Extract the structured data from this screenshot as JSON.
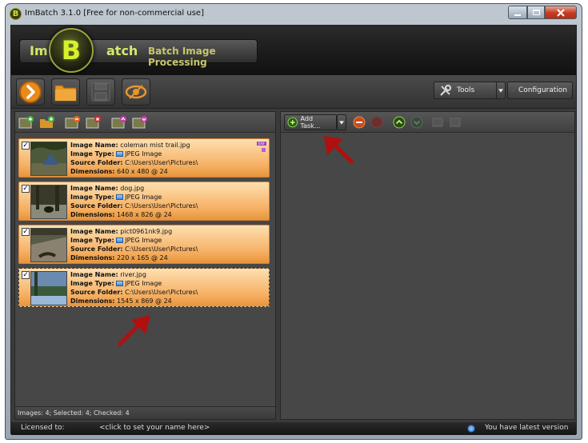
{
  "window": {
    "title": "ImBatch 3.1.0 [Free for non-commercial use]",
    "badge": "B"
  },
  "banner": {
    "logo_left": "Im",
    "logo_center": "B",
    "logo_right": "atch",
    "tagline": "Batch Image Processing"
  },
  "toolbar": {
    "tools_label": "Tools",
    "configuration_label": "Configuration"
  },
  "right_toolbar": {
    "add_task_label": "Add Task..."
  },
  "labels": {
    "image_name": "Image Name:",
    "image_type": "Image Type:",
    "source_folder": "Source Folder:",
    "dimensions": "Dimensions:",
    "exif": "EXIF"
  },
  "images": [
    {
      "checked": "✓",
      "name": "coleman mist trail.jpg",
      "type": "JPEG Image",
      "folder": "C:\\Users\\User\\Pictures\\",
      "dimensions": "640 x 480 @ 24"
    },
    {
      "checked": "✓",
      "name": "dog.jpg",
      "type": "JPEG Image",
      "folder": "C:\\Users\\User\\Pictures\\",
      "dimensions": "1468 x 826 @ 24"
    },
    {
      "checked": "✓",
      "name": "pict0961nk9.jpg",
      "type": "JPEG Image",
      "folder": "C:\\Users\\User\\Pictures\\",
      "dimensions": "220 x 165 @ 24"
    },
    {
      "checked": "✓",
      "name": "river.jpg",
      "type": "JPEG Image",
      "folder": "C:\\Users\\User\\Pictures\\",
      "dimensions": "1545 x 869 @ 24"
    }
  ],
  "left_status": "Images: 4; Selected: 4; Checked: 4",
  "statusbar": {
    "licensed_label": "Licensed to:",
    "name_prompt": "<click to set your name here>",
    "version_text": "You have latest version"
  },
  "colors": {
    "accent": "#d9f030",
    "item_top": "#fde0b0",
    "item_bottom": "#e8943a",
    "arrow": "#b01010"
  }
}
